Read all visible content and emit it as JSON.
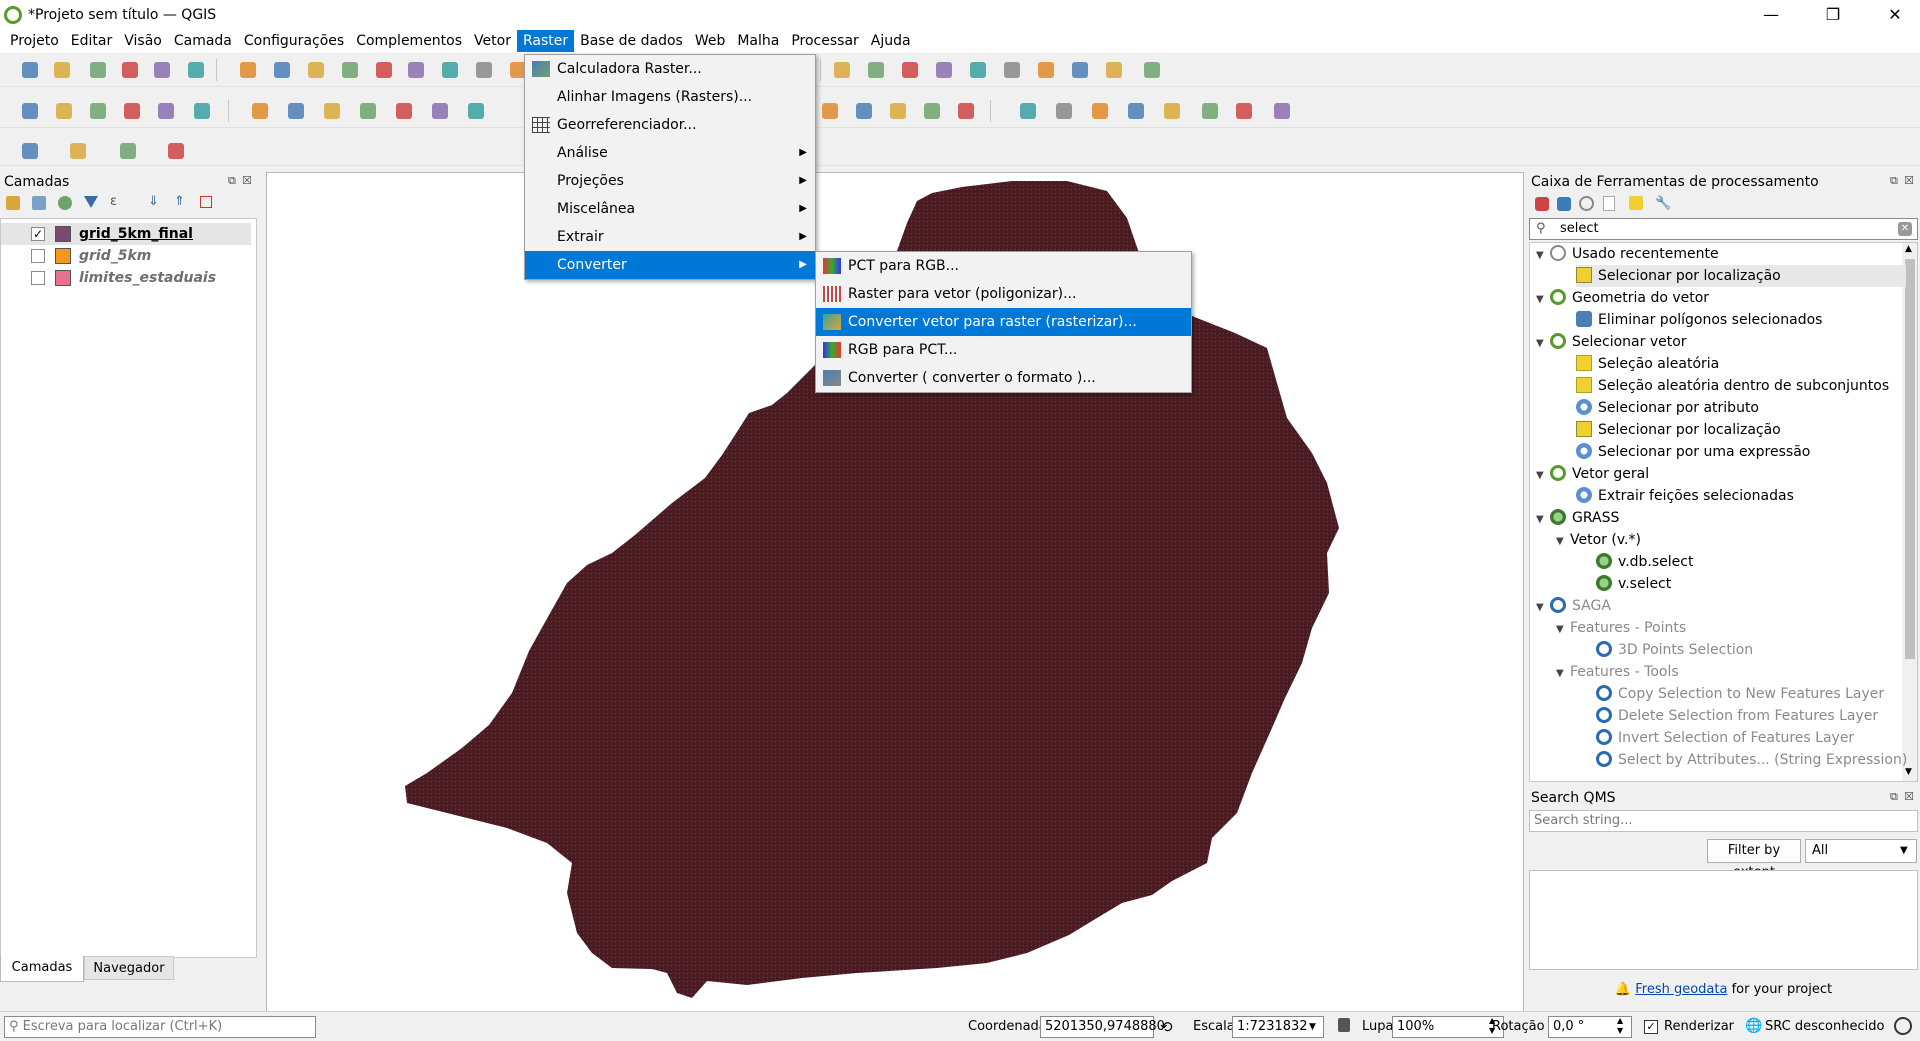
{
  "window": {
    "title": "*Projeto sem título — QGIS",
    "minimize": "—",
    "maximize": "❐",
    "close": "✕"
  },
  "menubar": {
    "items": [
      "Projeto",
      "Editar",
      "Visão",
      "Camada",
      "Configurações",
      "Complementos",
      "Vetor",
      "Raster",
      "Base de dados",
      "Web",
      "Malha",
      "Processar",
      "Ajuda"
    ],
    "active": "Raster"
  },
  "raster_menu": {
    "items": [
      {
        "label": "Calculadora Raster...",
        "icon": "raster-calculator-icon"
      },
      {
        "label": "Alinhar Imagens (Rasters)...",
        "icon": ""
      },
      {
        "label": "Georreferenciador...",
        "icon": "georeferencer-icon"
      },
      {
        "label": "Análise",
        "submenu": true
      },
      {
        "label": "Projeções",
        "submenu": true
      },
      {
        "label": "Miscelânea",
        "submenu": true
      },
      {
        "label": "Extrair",
        "submenu": true
      },
      {
        "label": "Converter",
        "submenu": true,
        "highlighted": true
      }
    ]
  },
  "converter_submenu": {
    "items": [
      {
        "label": "PCT para RGB...",
        "icon": "pct-to-rgb-icon"
      },
      {
        "label": "Raster para vetor (poligonizar)...",
        "icon": "polygonize-icon"
      },
      {
        "label": "Converter vetor para raster (rasterizar)...",
        "icon": "rasterize-icon",
        "highlighted": true
      },
      {
        "label": "RGB para PCT...",
        "icon": "rgb-to-pct-icon"
      },
      {
        "label": "Converter ( converter o formato )...",
        "icon": "translate-icon"
      }
    ]
  },
  "layers_panel": {
    "title": "Camadas",
    "layers": [
      {
        "name": "grid_5km_final",
        "checked": true,
        "color": "#7b4a6e",
        "active": true
      },
      {
        "name": "grid_5km",
        "checked": false,
        "color": "#f39a1e",
        "active": false
      },
      {
        "name": "limites_estaduais",
        "checked": false,
        "color": "#e8728e",
        "active": false
      }
    ],
    "tabs": [
      "Camadas",
      "Navegador"
    ]
  },
  "map": {
    "fill_color": "#4a1c22"
  },
  "toolbox": {
    "title": "Caixa de Ferramentas de processamento",
    "search_value": "select",
    "tree": [
      {
        "label": "Usado recentemente",
        "level": 0,
        "expanded": true,
        "icon": "clock-icon"
      },
      {
        "label": "Selecionar por localização",
        "level": 1,
        "icon": "select-location-icon",
        "selected": true
      },
      {
        "label": "Geometria do vetor",
        "level": 0,
        "expanded": true,
        "icon": "qgis-icon"
      },
      {
        "label": "Eliminar polígonos selecionados",
        "level": 1,
        "icon": "eliminate-icon"
      },
      {
        "label": "Selecionar vetor",
        "level": 0,
        "expanded": true,
        "icon": "qgis-icon"
      },
      {
        "label": "Seleção aleatória",
        "level": 1,
        "icon": "random-select-icon"
      },
      {
        "label": "Seleção aleatória dentro de subconjuntos",
        "level": 1,
        "icon": "random-select-icon"
      },
      {
        "label": "Selecionar por atributo",
        "level": 1,
        "icon": "gear-icon"
      },
      {
        "label": "Selecionar por localização",
        "level": 1,
        "icon": "select-location-icon"
      },
      {
        "label": "Selecionar por uma expressão",
        "level": 1,
        "icon": "gear-icon"
      },
      {
        "label": "Vetor geral",
        "level": 0,
        "expanded": true,
        "icon": "qgis-icon"
      },
      {
        "label": "Extrair feições selecionadas",
        "level": 1,
        "icon": "gear-icon"
      },
      {
        "label": "GRASS",
        "level": 0,
        "expanded": true,
        "icon": "grass-icon"
      },
      {
        "label": "Vetor (v.*)",
        "level": 1,
        "expanded": true,
        "icon": ""
      },
      {
        "label": "v.db.select",
        "level": 2,
        "icon": "grass-icon"
      },
      {
        "label": "v.select",
        "level": 2,
        "icon": "grass-icon"
      },
      {
        "label": "SAGA",
        "level": 0,
        "expanded": true,
        "icon": "saga-icon",
        "disabled": true
      },
      {
        "label": "Features - Points",
        "level": 1,
        "expanded": true,
        "icon": "",
        "disabled": true
      },
      {
        "label": "3D Points Selection",
        "level": 2,
        "icon": "saga-icon",
        "disabled": true
      },
      {
        "label": "Features - Tools",
        "level": 1,
        "expanded": true,
        "icon": "",
        "disabled": true
      },
      {
        "label": "Copy Selection to New Features Layer",
        "level": 2,
        "icon": "saga-icon",
        "disabled": true
      },
      {
        "label": "Delete Selection from Features Layer",
        "level": 2,
        "icon": "saga-icon",
        "disabled": true
      },
      {
        "label": "Invert Selection of Features Layer",
        "level": 2,
        "icon": "saga-icon",
        "disabled": true
      },
      {
        "label": "Select by Attributes... (String Expression)",
        "level": 2,
        "icon": "saga-icon",
        "disabled": true
      }
    ]
  },
  "qms": {
    "title": "Search QMS",
    "placeholder": "Search string...",
    "filter_label": "Filter by extent",
    "dropdown_value": "All",
    "footer_link": "Fresh geodata",
    "footer_text": " for your project"
  },
  "statusbar": {
    "locator_placeholder": "Escreva para localizar (Ctrl+K)",
    "coord_label": "Coordenada",
    "coord_value": "5201350,9748880",
    "scale_label": "Escala",
    "scale_value": "1:7231832",
    "magnifier_label": "Lupa",
    "magnifier_value": "100%",
    "rotation_label": "Rotação",
    "rotation_value": "0,0 °",
    "render_label": "Renderizar",
    "crs_label": "SRC desconhecido"
  }
}
